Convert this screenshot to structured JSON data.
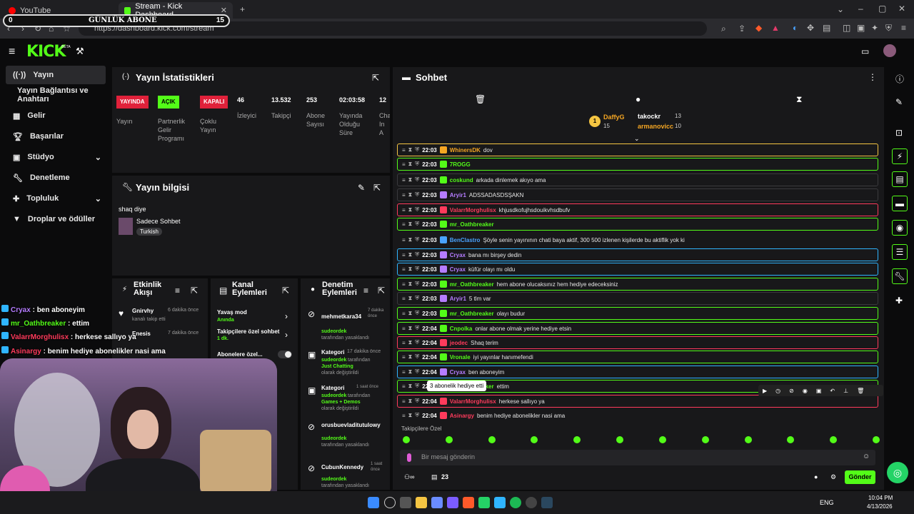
{
  "browser": {
    "tabs": [
      {
        "label": "YouTube"
      },
      {
        "label": "Stream - Kick Dashboard"
      }
    ],
    "url": "https://dashboard.kick.com/stream",
    "overlay_banner": {
      "left": "0",
      "title": "GÜNLÜK ABONE",
      "right": "15"
    }
  },
  "header": {
    "logo": "KICK",
    "beta": "BETA"
  },
  "sidebar": {
    "items": [
      {
        "label": "Yayın"
      },
      {
        "label": "Yayın Bağlantısı ve Anahtarı"
      },
      {
        "label": "Gelir"
      },
      {
        "label": "Başarılar"
      },
      {
        "label": "Stüdyo"
      },
      {
        "label": "Denetleme"
      },
      {
        "label": "Topluluk"
      },
      {
        "label": "Droplar ve ödüller"
      }
    ]
  },
  "stats": {
    "title": "Yayın İstatistikleri",
    "cols": [
      {
        "badge": "YAYINDA",
        "label": "Yayın"
      },
      {
        "badge": "AÇIK",
        "label": "Partnerlik Gelir Programı"
      },
      {
        "badge": "KAPALI",
        "label": "Çoklu Yayın"
      },
      {
        "value": "46",
        "label": "İzleyici"
      },
      {
        "value": "13.532",
        "label": "Takipçi"
      },
      {
        "value": "253",
        "label": "Abone Sayısı"
      },
      {
        "value": "02:03:58",
        "label": "Yayında Olduğu Süre"
      },
      {
        "value": "12",
        "label": "Cha In A"
      }
    ]
  },
  "info": {
    "title": "Yayın bilgisi",
    "stream_title": "shaq diye",
    "category": "Sadece Sohbet",
    "tag": "Turkish"
  },
  "events": {
    "title": "Etkinlik Akışı",
    "items": [
      {
        "user": "Gnirvhy",
        "time": "6 dakika önce",
        "desc": "kanalı takip etti"
      },
      {
        "user": "Enesis",
        "time": "7 dakika önce",
        "desc": ""
      }
    ]
  },
  "actions": {
    "title": "Kanal Eylemleri",
    "slow": "Yavaş mod",
    "slow_sub": "Anında",
    "followers": "Takipçilere özel sohbet",
    "followers_sub": "1 dk.",
    "subs": "Abonelere özel..."
  },
  "mod": {
    "title": "Denetim Eylemleri",
    "items": [
      {
        "user": "mehmetkara34",
        "time": "7 dakika önce",
        "by": "sudeordek",
        "action": "tarafından yasaklandı"
      },
      {
        "user": "Kategori",
        "time": "17 dakika önce",
        "by": "sudeordek",
        "action": "tarafından",
        "extra": "Just Chatting",
        "extra2": "olarak değiştirildi"
      },
      {
        "user": "Kategori",
        "time": "1 saat önce",
        "by": "sudeordek",
        "action": "tarafından",
        "extra": "Games + Demos",
        "extra2": "olarak değiştirildi"
      },
      {
        "user": "orusbuevladitutulowy",
        "time": "",
        "by": "sudeordek",
        "action": "tarafından yasaklandı"
      },
      {
        "user": "CubunKennedy",
        "time": "1 saat önce",
        "by": "sudeordek",
        "action": "tarafından yasaklandı"
      }
    ]
  },
  "chat": {
    "title": "Sohbet",
    "leaders": [
      {
        "name": "DaffyG",
        "count": "15"
      },
      {
        "name": "takockr",
        "count": "13"
      },
      {
        "name": "armanovicc",
        "count": "10"
      }
    ],
    "messages": [
      {
        "time": "22:03",
        "user": "WhinersDK",
        "color": "#f5a623",
        "text": "dov",
        "border": "#f5c542"
      },
      {
        "time": "22:03",
        "user": "7ROGG",
        "color": "#53fc18",
        "text": "",
        "border": "#53fc18"
      },
      {
        "time": "22:03",
        "user": "coskund",
        "color": "#53fc18",
        "text": "arkada dinlemek akıyo ama",
        "border": "#3a3a3d"
      },
      {
        "time": "22:03",
        "user": "Aryir1",
        "color": "#b57cff",
        "text": "ADSSADASDSŞAKN",
        "border": "#3a3a3d"
      },
      {
        "time": "22:03",
        "user": "ValarrMorghulisx",
        "color": "#ff3b5c",
        "text": "khjusdkofujhsdouikvhsdbufv",
        "border": "#ff3b5c"
      },
      {
        "time": "22:03",
        "user": "mr_Oathbreaker",
        "color": "#53fc18",
        "text": "",
        "border": "#53fc18"
      },
      {
        "time": "22:03",
        "user": "BenClastro",
        "color": "#4aa3ff",
        "text": "Şöyle senin yayınının chati baya aktif, 300 500 izlenen kişilerde bu aktiflik yok ki",
        "border": "#18181a"
      },
      {
        "time": "22:03",
        "user": "Cryax",
        "color": "#b57cff",
        "text": "bana mı birşey dedin",
        "border": "#2fb5ff"
      },
      {
        "time": "22:03",
        "user": "Cryax",
        "color": "#b57cff",
        "text": "küfür olayı mı oldu",
        "border": "#2fb5ff"
      },
      {
        "time": "22:03",
        "user": "mr_Oathbreaker",
        "color": "#53fc18",
        "text": "hem abone olucaksınız hem hediye edeceksiniz",
        "border": "#53fc18"
      },
      {
        "time": "22:03",
        "user": "Aryir1",
        "color": "#b57cff",
        "text": "5 tlm var",
        "border": "#3a3a3d"
      },
      {
        "time": "22:03",
        "user": "mr_Oathbreaker",
        "color": "#53fc18",
        "text": "olayı budur",
        "border": "#53fc18"
      },
      {
        "time": "22:04",
        "user": "Cnpolka",
        "color": "#53fc18",
        "text": "onlar abone olmak yerine hediye etsin",
        "border": "#53fc18"
      },
      {
        "time": "22:04",
        "user": "jeodec",
        "color": "#ff3b5c",
        "text": "Shaq terim",
        "border": "#ff3b5c"
      },
      {
        "time": "22:04",
        "user": "Vronale",
        "color": "#53fc18",
        "text": "iyi yayınlar hanımefendi",
        "border": "#53fc18"
      },
      {
        "time": "22:04",
        "user": "Cryax",
        "color": "#b57cff",
        "text": "ben aboneyim",
        "border": "#2fb5ff"
      },
      {
        "time": "22:04",
        "user": "mr_Oathbreaker",
        "color": "#53fc18",
        "text": "ettim",
        "border": "#53fc18"
      },
      {
        "time": "22:04",
        "user": "ValarrMorghulisx",
        "color": "#ff3b5c",
        "text": "herkese sallıyo ya",
        "border": "#ff3b5c"
      },
      {
        "time": "22:04",
        "user": "Asinargy",
        "color": "#ff3b5c",
        "text": "benim hediye abonelikler nasi ama",
        "border": "#18181a"
      }
    ],
    "tooltip": "3 abonelik hediye etti",
    "followers_only": "Takipçilere Özel",
    "placeholder": "Bir mesaj gönderin",
    "viewer_count": "23",
    "send": "Gönder"
  },
  "overlay_chat": [
    {
      "user": "Cryax",
      "color": "#b57cff",
      "text": "ben aboneyim"
    },
    {
      "user": "mr_Oathbreaker",
      "color": "#53fc18",
      "text": "ettim"
    },
    {
      "user": "ValarrMorghulisx",
      "color": "#ff3b5c",
      "text": "herkese sallıyo ya"
    },
    {
      "user": "Asinargy",
      "color": "#ff3b5c",
      "text": "benim hediye abonelikler nasi ama"
    }
  ],
  "taskbar": {
    "lang": "ENG",
    "time": "10:04 PM",
    "date": "4/13/2026"
  }
}
